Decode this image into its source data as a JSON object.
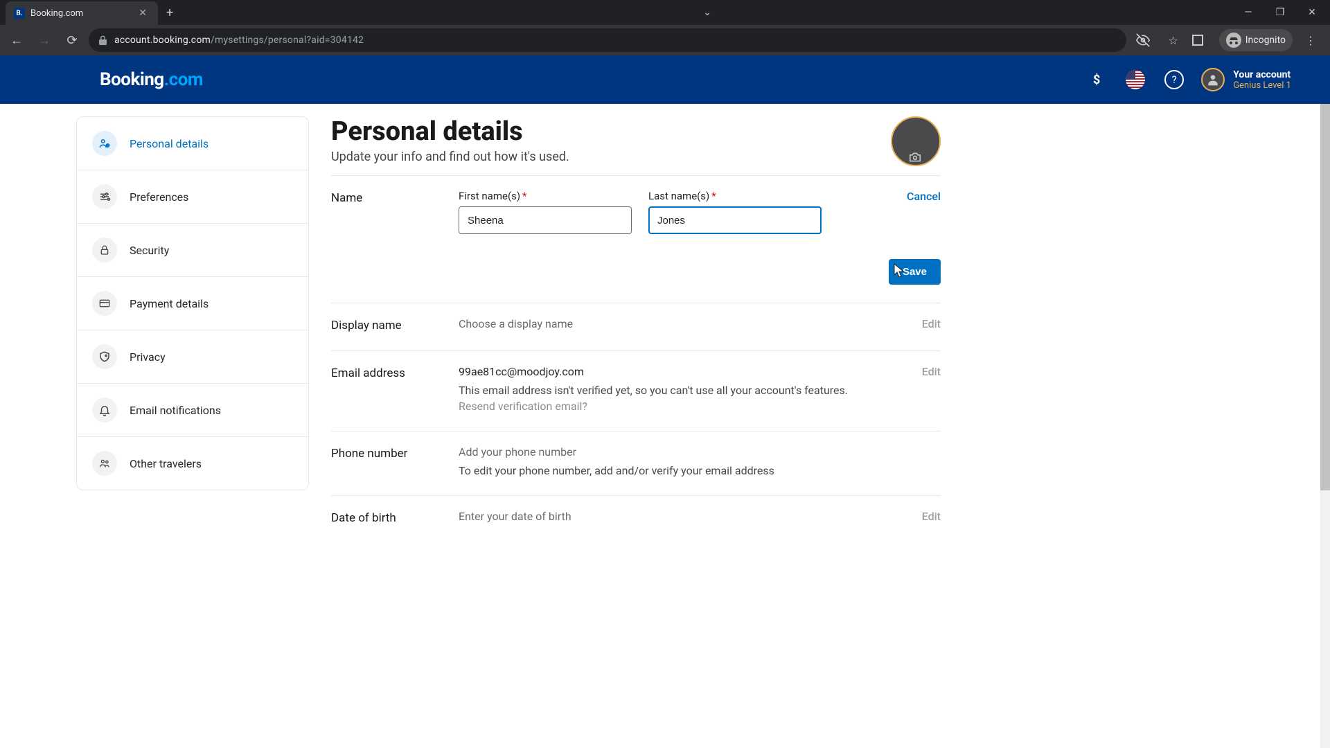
{
  "browser": {
    "tab_title": "Booking.com",
    "url_host": "account.booking.com",
    "url_path": "/mysettings/personal?aid=304142",
    "incognito_label": "Incognito"
  },
  "header": {
    "logo_text": "Booking",
    "logo_suffix": ".com",
    "currency": "$",
    "account_name": "Your account",
    "account_level": "Genius Level 1"
  },
  "sidebar": {
    "items": [
      {
        "label": "Personal details",
        "icon": "user-plus-icon",
        "active": true
      },
      {
        "label": "Preferences",
        "icon": "sliders-icon"
      },
      {
        "label": "Security",
        "icon": "lock-icon"
      },
      {
        "label": "Payment details",
        "icon": "credit-card-icon"
      },
      {
        "label": "Privacy",
        "icon": "shield-icon"
      },
      {
        "label": "Email notifications",
        "icon": "bell-icon"
      },
      {
        "label": "Other travelers",
        "icon": "people-icon"
      }
    ]
  },
  "page": {
    "title": "Personal details",
    "subtitle": "Update your info and find out how it's used.",
    "sections": {
      "name": {
        "label": "Name",
        "first_label": "First name(s)",
        "last_label": "Last name(s)",
        "first_value": "Sheena",
        "last_value": "Jones",
        "cancel": "Cancel",
        "save": "Save"
      },
      "display_name": {
        "label": "Display name",
        "placeholder": "Choose a display name",
        "action": "Edit"
      },
      "email": {
        "label": "Email address",
        "value": "99ae81cc@moodjoy.com",
        "helper": "This email address isn't verified yet, so you can't use all your account's features.",
        "resend": "Resend verification email?",
        "action": "Edit"
      },
      "phone": {
        "label": "Phone number",
        "placeholder": "Add your phone number",
        "helper": "To edit your phone number, add and/or verify your email address"
      },
      "dob": {
        "label": "Date of birth",
        "placeholder": "Enter your date of birth",
        "action": "Edit"
      }
    }
  }
}
